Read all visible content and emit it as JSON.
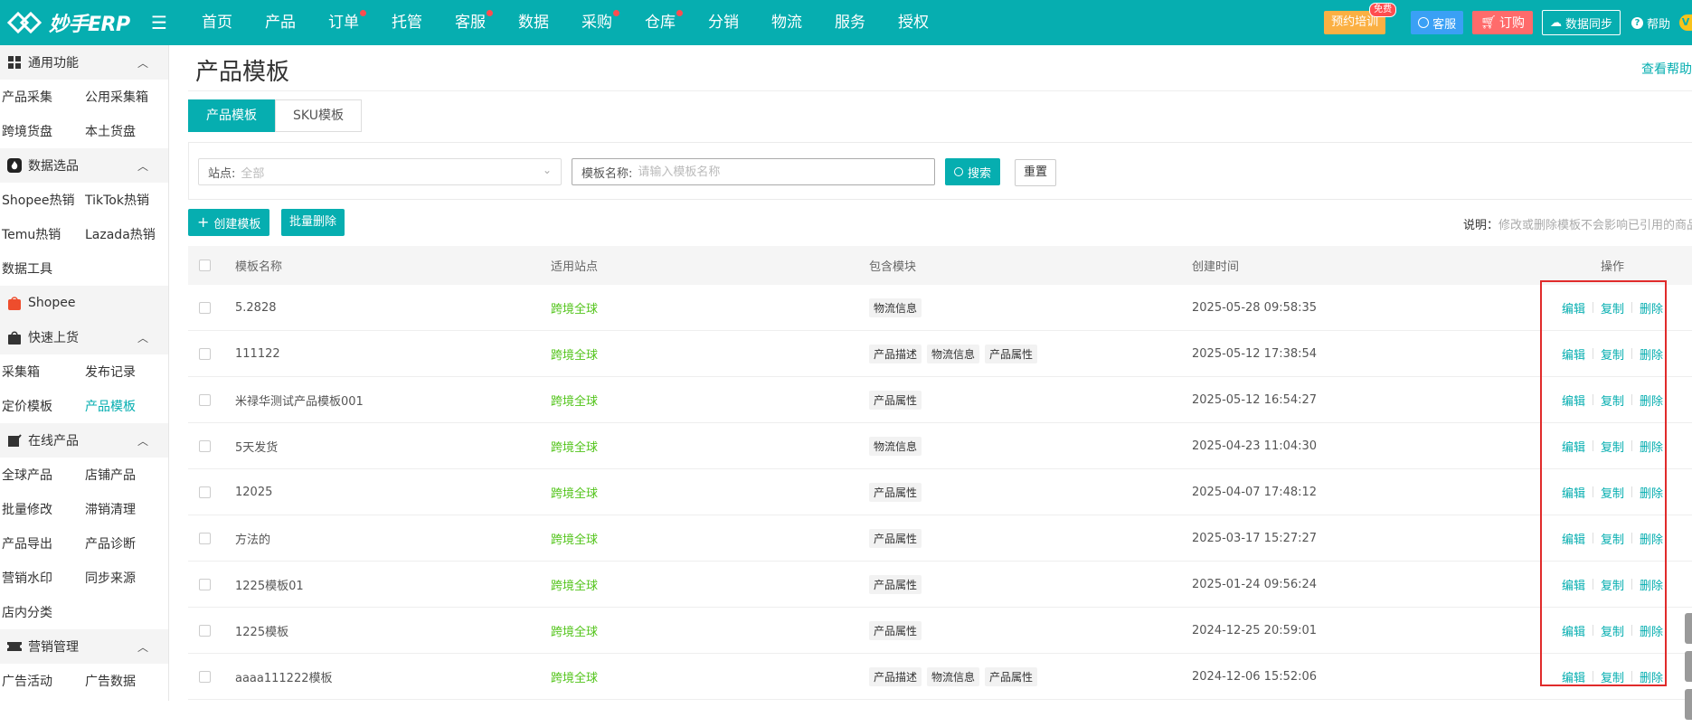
{
  "brand": {
    "logo_text": "妙手ERP",
    "accent": "#06aeb0"
  },
  "nav": [
    {
      "label": "首页",
      "dot": false
    },
    {
      "label": "产品",
      "dot": false
    },
    {
      "label": "订单",
      "dot": true
    },
    {
      "label": "托管",
      "dot": false
    },
    {
      "label": "客服",
      "dot": true
    },
    {
      "label": "数据",
      "dot": false
    },
    {
      "label": "采购",
      "dot": true
    },
    {
      "label": "仓库",
      "dot": true
    },
    {
      "label": "分销",
      "dot": false
    },
    {
      "label": "物流",
      "dot": false
    },
    {
      "label": "服务",
      "dot": false
    },
    {
      "label": "授权",
      "dot": false
    }
  ],
  "topright": {
    "train": "预约培训",
    "free": "免费",
    "service": "客服",
    "order": "订购",
    "sync": "数据同步",
    "help": "帮助",
    "vip": "V"
  },
  "sidebar": [
    {
      "title": "通用功能",
      "icon": "grid-icon",
      "items": [
        [
          "产品采集",
          "公用采集箱"
        ],
        [
          "跨境货盘",
          "本土货盘"
        ]
      ]
    },
    {
      "title": "数据选品",
      "icon": "fire-icon",
      "items": [
        [
          "Shopee热销",
          "TikTok热销"
        ],
        [
          "Temu热销",
          "Lazada热销"
        ],
        [
          "数据工具"
        ]
      ]
    },
    {
      "title": "Shopee",
      "icon": "shopee-icon",
      "items": []
    },
    {
      "title": "快速上货",
      "icon": "bag-icon",
      "items": [
        [
          "采集箱",
          "发布记录"
        ],
        [
          "定价模板",
          "产品模板"
        ]
      ]
    },
    {
      "title": "在线产品",
      "icon": "edit-icon",
      "items": [
        [
          "全球产品",
          "店铺产品"
        ],
        [
          "批量修改",
          "滞销清理"
        ],
        [
          "产品导出",
          "产品诊断"
        ],
        [
          "营销水印",
          "同步来源"
        ],
        [
          "店内分类"
        ]
      ]
    },
    {
      "title": "营销管理",
      "icon": "ticket-icon",
      "items": [
        [
          "广告活动",
          "广告数据"
        ]
      ]
    }
  ],
  "sidebar_active": "产品模板",
  "page": {
    "title": "产品模板",
    "help_link": "查看帮助",
    "tabs": [
      "产品模板",
      "SKU模板"
    ],
    "filter": {
      "station_label": "站点:",
      "station_value": "全部",
      "name_label": "模板名称:",
      "name_placeholder": "请输入模板名称",
      "search": "搜索",
      "reset": "重置"
    },
    "create": "创建模板",
    "batch_delete": "批量删除",
    "note_key": "说明：",
    "note_value": "修改或删除模板不会影响已引用的商品"
  },
  "table": {
    "headers": [
      "模板名称",
      "适用站点",
      "包含模块",
      "创建时间",
      "操作"
    ],
    "ops": [
      "编辑",
      "复制",
      "删除"
    ],
    "rows": [
      {
        "name": "5.2828",
        "site": "跨境全球",
        "modules": [
          "物流信息"
        ],
        "time": "2025-05-28 09:58:35"
      },
      {
        "name": "111122",
        "site": "跨境全球",
        "modules": [
          "产品描述",
          "物流信息",
          "产品属性"
        ],
        "time": "2025-05-12 17:38:54"
      },
      {
        "name": "米禄华测试产品模板001",
        "site": "跨境全球",
        "modules": [
          "产品属性"
        ],
        "time": "2025-05-12 16:54:27"
      },
      {
        "name": "5天发货",
        "site": "跨境全球",
        "modules": [
          "物流信息"
        ],
        "time": "2025-04-23 11:04:30"
      },
      {
        "name": "12025",
        "site": "跨境全球",
        "modules": [
          "产品属性"
        ],
        "time": "2025-04-07 17:48:12"
      },
      {
        "name": "方法的",
        "site": "跨境全球",
        "modules": [
          "产品属性"
        ],
        "time": "2025-03-17 15:27:27"
      },
      {
        "name": "1225模板01",
        "site": "跨境全球",
        "modules": [
          "产品属性"
        ],
        "time": "2025-01-24 09:56:24"
      },
      {
        "name": "1225模板",
        "site": "跨境全球",
        "modules": [
          "产品属性"
        ],
        "time": "2024-12-25 20:59:01"
      },
      {
        "name": "aaaa111222模板",
        "site": "跨境全球",
        "modules": [
          "产品描述",
          "物流信息",
          "产品属性"
        ],
        "time": "2024-12-06 15:52:06"
      }
    ]
  }
}
